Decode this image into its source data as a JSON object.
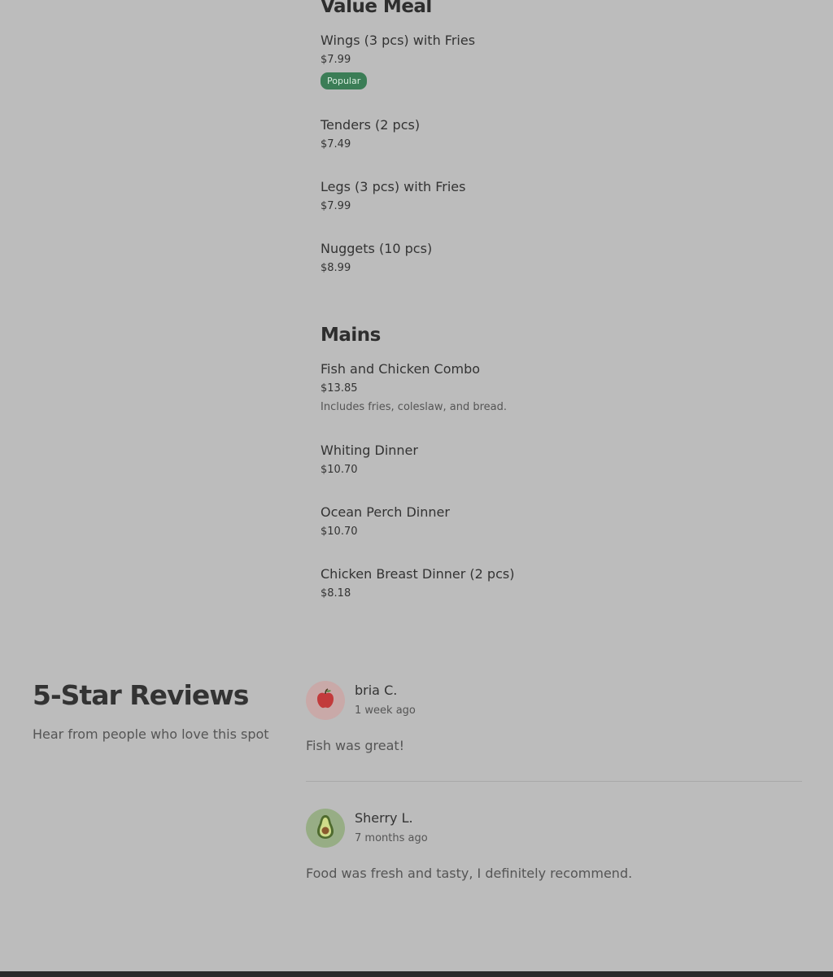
{
  "menu": {
    "value_meal": {
      "title": "Value Meal",
      "items": [
        {
          "name": "Wings (3 pcs) with Fries",
          "price": "$7.99",
          "badge": "Popular"
        },
        {
          "name": "Tenders (2 pcs)",
          "price": "$7.49"
        },
        {
          "name": "Legs (3 pcs) with Fries",
          "price": "$7.99"
        },
        {
          "name": "Nuggets (10 pcs)",
          "price": "$8.99"
        }
      ]
    },
    "mains": {
      "title": "Mains",
      "items": [
        {
          "name": "Fish and Chicken Combo",
          "price": "$13.85",
          "description": "Includes fries, coleslaw, and bread."
        },
        {
          "name": "Whiting Dinner",
          "price": "$10.70"
        },
        {
          "name": "Ocean Perch Dinner",
          "price": "$10.70"
        },
        {
          "name": "Chicken Breast Dinner (2 pcs)",
          "price": "$8.18"
        }
      ]
    }
  },
  "reviews": {
    "title": "5-Star Reviews",
    "subtitle": "Hear from people who love this spot",
    "items": [
      {
        "name": "bria C.",
        "time": "1 week ago",
        "text": "Fish was great!",
        "avatar_icon": "apple-icon"
      },
      {
        "name": "Sherry L.",
        "time": "7 months ago",
        "text": "Food was fresh and tasty, I definitely recommend.",
        "avatar_icon": "avocado-icon"
      }
    ]
  },
  "colors": {
    "background": "#bcbcbc",
    "badge": "#3b7d56",
    "footer": "#2b2b2b"
  }
}
